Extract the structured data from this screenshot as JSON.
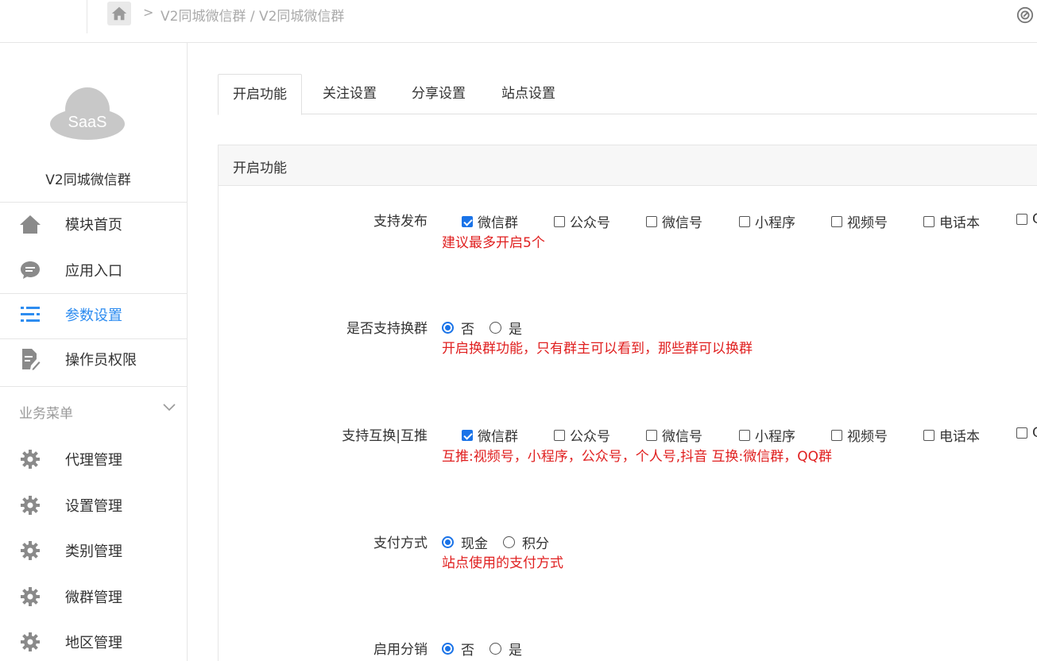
{
  "header": {
    "breadcrumb_sep": ">",
    "breadcrumb": "V2同城微信群 / V2同城微信群"
  },
  "sidebar": {
    "logo_text": "SaaS",
    "app_name": "V2同城微信群",
    "items": [
      {
        "label": "模块首页",
        "icon": "home-icon"
      },
      {
        "label": "应用入口",
        "icon": "chat-icon"
      },
      {
        "label": "参数设置",
        "icon": "list-settings-icon"
      },
      {
        "label": "操作员权限",
        "icon": "document-edit-icon"
      }
    ],
    "group_title": "业务菜单",
    "group_items": [
      {
        "label": "代理管理",
        "icon": "gear-icon"
      },
      {
        "label": "设置管理",
        "icon": "gear-icon"
      },
      {
        "label": "类别管理",
        "icon": "gear-icon"
      },
      {
        "label": "微群管理",
        "icon": "gear-icon"
      },
      {
        "label": "地区管理",
        "icon": "gear-icon"
      }
    ],
    "active_color": "#2d8cf0"
  },
  "tabs": [
    {
      "label": "开启功能"
    },
    {
      "label": "关注设置"
    },
    {
      "label": "分享设置"
    },
    {
      "label": "站点设置"
    }
  ],
  "panel": {
    "title": "开启功能",
    "rows": [
      {
        "label": "支持发布",
        "type": "checkbox",
        "options": [
          {
            "label": "微信群",
            "checked": true
          },
          {
            "label": "公众号",
            "checked": false
          },
          {
            "label": "微信号",
            "checked": false
          },
          {
            "label": "小程序",
            "checked": false
          },
          {
            "label": "视频号",
            "checked": false
          },
          {
            "label": "电话本",
            "checked": false
          },
          {
            "label": "Q",
            "checked": false
          }
        ],
        "hint": "建议最多开启5个"
      },
      {
        "label": "是否支持换群",
        "type": "radio",
        "options": [
          {
            "label": "否",
            "checked": true
          },
          {
            "label": "是",
            "checked": false
          }
        ],
        "hint": "开启换群功能，只有群主可以看到，那些群可以换群"
      },
      {
        "label": "支持互换|互推",
        "type": "checkbox",
        "options": [
          {
            "label": "微信群",
            "checked": true
          },
          {
            "label": "公众号",
            "checked": false
          },
          {
            "label": "微信号",
            "checked": false
          },
          {
            "label": "小程序",
            "checked": false
          },
          {
            "label": "视频号",
            "checked": false
          },
          {
            "label": "电话本",
            "checked": false
          },
          {
            "label": "Q",
            "checked": false
          }
        ],
        "hint": "互推:视频号，小程序，公众号，个人号,抖音 互换:微信群，QQ群"
      },
      {
        "label": "支付方式",
        "type": "radio",
        "options": [
          {
            "label": "现金",
            "checked": true
          },
          {
            "label": "积分",
            "checked": false
          }
        ],
        "hint": "站点使用的支付方式"
      },
      {
        "label": "启用分销",
        "type": "radio",
        "options": [
          {
            "label": "否",
            "checked": true
          },
          {
            "label": "是",
            "checked": false
          }
        ],
        "hint": ""
      }
    ],
    "hint_color": "#e02020",
    "accent_color": "#1a73e8"
  }
}
